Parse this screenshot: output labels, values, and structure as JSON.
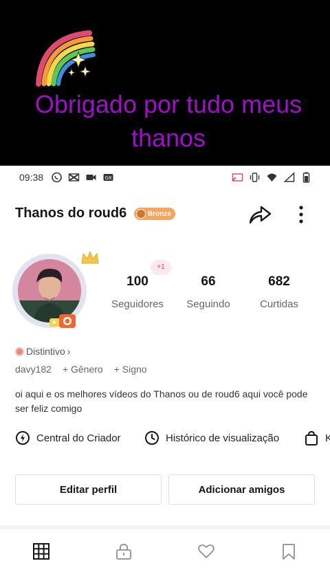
{
  "overlay": {
    "caption_line1": "Obrigado por tudo meus",
    "caption_line2": "thanos",
    "caption_color": "#a010c8",
    "sticker": "rainbow-sparkle-icon"
  },
  "status_bar": {
    "time": "09:38",
    "left_icons": [
      "whatsapp-icon",
      "capcut-icon",
      "video-icon",
      "gb-icon"
    ],
    "right_icons": [
      "cast-icon",
      "vibrate-icon",
      "wifi-icon",
      "signal-icon",
      "battery-icon"
    ]
  },
  "profile": {
    "title": "Thanos do roud6",
    "badge_label": "Bronze",
    "badge_color": "#f5a55d",
    "new_follower_badge": "+1",
    "stats": [
      {
        "value": "100",
        "label": "Seguidores"
      },
      {
        "value": "66",
        "label": "Seguindo"
      },
      {
        "value": "682",
        "label": "Curtidas"
      }
    ],
    "distintivo": "Distintivo",
    "handle": "davy182",
    "genero": "+ Gênero",
    "signo": "+ Signo",
    "bio": "oi aqui e os melhores vídeos do Thanos ou de roud6 aqui você pode ser feliz comigo"
  },
  "tools": [
    {
      "icon": "lightning-icon",
      "label": "Central do Criador"
    },
    {
      "icon": "clock-icon",
      "label": "Histórico de visualização"
    },
    {
      "icon": "bag-icon",
      "label": "K"
    }
  ],
  "buttons": {
    "edit": "Editar perfil",
    "add_friends": "Adicionar amigos"
  },
  "tabs": [
    "grid-icon",
    "lock-icon",
    "heart-icon",
    "bookmark-icon"
  ]
}
